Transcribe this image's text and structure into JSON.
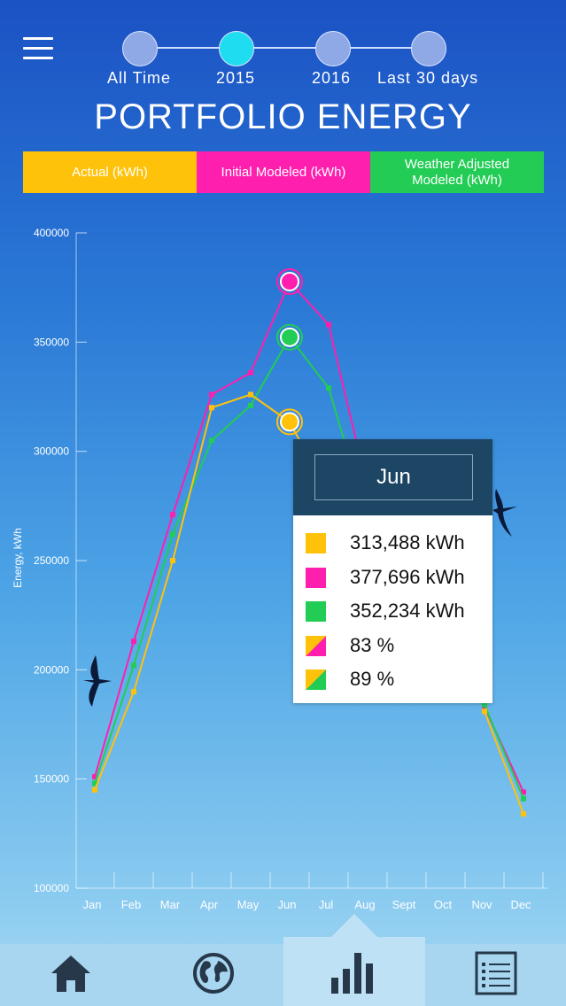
{
  "nav": {
    "periods": [
      {
        "label": "All Time",
        "active": false
      },
      {
        "label": "2015",
        "active": true
      },
      {
        "label": "2016",
        "active": false
      },
      {
        "label": "Last 30 days",
        "active": false
      }
    ]
  },
  "title": "PORTFOLIO ENERGY",
  "legend": [
    {
      "label": "Actual (kWh)",
      "color": "#ffc20a"
    },
    {
      "label": "Initial Modeled (kWh)",
      "color": "#ff1fae"
    },
    {
      "label": "Weather Adjusted Modeled (kWh)",
      "color": "#22cc55"
    }
  ],
  "chart_data": {
    "type": "line",
    "ylabel": "Energy, kWh",
    "ylim": [
      100000,
      400000
    ],
    "yticks": [
      "100000",
      "150000",
      "200000",
      "250000",
      "300000",
      "350000",
      "400000"
    ],
    "categories": [
      "Jan",
      "Feb",
      "Mar",
      "Apr",
      "May",
      "Jun",
      "Jul",
      "Aug",
      "Sept",
      "Oct",
      "Nov",
      "Dec"
    ],
    "series": [
      {
        "name": "Initial Modeled (kWh)",
        "color": "#ff1fae",
        "values": [
          151000,
          213000,
          271000,
          326000,
          336000,
          377696,
          358000,
          283000,
          null,
          null,
          183000,
          144000
        ]
      },
      {
        "name": "Weather Adjusted Modeled (kWh)",
        "color": "#22cc55",
        "values": [
          148000,
          202000,
          262000,
          305000,
          321000,
          352234,
          329000,
          269000,
          null,
          null,
          184000,
          141000
        ]
      },
      {
        "name": "Actual (kWh)",
        "color": "#ffc20a",
        "values": [
          145000,
          190000,
          250000,
          320000,
          326000,
          313488,
          280000,
          270000,
          null,
          null,
          181000,
          134000
        ]
      }
    ],
    "selected_index": 5,
    "grid": false
  },
  "tooltip": {
    "month": "Jun",
    "rows": [
      {
        "text": "313,488 kWh",
        "swatch": "#ffc20a"
      },
      {
        "text": "377,696 kWh",
        "swatch": "#ff1fae"
      },
      {
        "text": "352,234 kWh",
        "swatch": "#22cc55"
      },
      {
        "text": "83 %",
        "swatch_a": "#ffc20a",
        "swatch_b": "#ff1fae"
      },
      {
        "text": "89 %",
        "swatch_a": "#ffc20a",
        "swatch_b": "#22cc55"
      }
    ]
  },
  "tabs": [
    {
      "icon": "home-icon",
      "active": false
    },
    {
      "icon": "globe-icon",
      "active": false
    },
    {
      "icon": "bar-chart-icon",
      "active": true
    },
    {
      "icon": "list-icon",
      "active": false
    }
  ]
}
